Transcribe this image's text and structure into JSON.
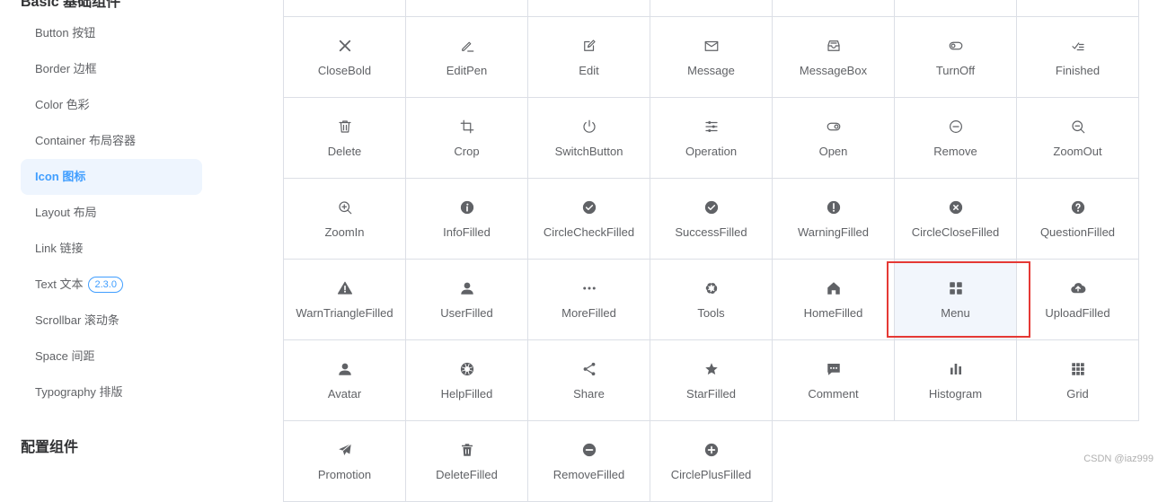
{
  "sidebar": {
    "group_basic": "Basic 基础组件",
    "items": [
      {
        "label": "Button 按钮"
      },
      {
        "label": "Border 边框"
      },
      {
        "label": "Color 色彩"
      },
      {
        "label": "Container 布局容器"
      },
      {
        "label": "Icon 图标",
        "active": true
      },
      {
        "label": "Layout 布局"
      },
      {
        "label": "Link 链接"
      },
      {
        "label": "Text 文本",
        "badge": "2.3.0"
      },
      {
        "label": "Scrollbar 滚动条"
      },
      {
        "label": "Space 间距"
      },
      {
        "label": "Typography 排版"
      }
    ],
    "group_config": "配置组件"
  },
  "icons": [
    {
      "label": "",
      "icon": "none"
    },
    {
      "label": "",
      "icon": "none"
    },
    {
      "label": "",
      "icon": "none"
    },
    {
      "label": "",
      "icon": "none"
    },
    {
      "label": "",
      "icon": "none"
    },
    {
      "label": "",
      "icon": "none"
    },
    {
      "label": "",
      "icon": "none"
    },
    {
      "label": "CloseBold",
      "icon": "close-bold-icon"
    },
    {
      "label": "EditPen",
      "icon": "edit-pen-icon"
    },
    {
      "label": "Edit",
      "icon": "edit-icon"
    },
    {
      "label": "Message",
      "icon": "message-icon"
    },
    {
      "label": "MessageBox",
      "icon": "message-box-icon"
    },
    {
      "label": "TurnOff",
      "icon": "turn-off-icon"
    },
    {
      "label": "Finished",
      "icon": "finished-icon"
    },
    {
      "label": "Delete",
      "icon": "delete-icon"
    },
    {
      "label": "Crop",
      "icon": "crop-icon"
    },
    {
      "label": "SwitchButton",
      "icon": "switch-button-icon"
    },
    {
      "label": "Operation",
      "icon": "operation-icon"
    },
    {
      "label": "Open",
      "icon": "open-icon"
    },
    {
      "label": "Remove",
      "icon": "remove-icon"
    },
    {
      "label": "ZoomOut",
      "icon": "zoom-out-icon"
    },
    {
      "label": "ZoomIn",
      "icon": "zoom-in-icon"
    },
    {
      "label": "InfoFilled",
      "icon": "info-filled-icon"
    },
    {
      "label": "CircleCheckFilled",
      "icon": "circle-check-filled-icon"
    },
    {
      "label": "SuccessFilled",
      "icon": "success-filled-icon"
    },
    {
      "label": "WarningFilled",
      "icon": "warning-filled-icon"
    },
    {
      "label": "CircleCloseFilled",
      "icon": "circle-close-filled-icon"
    },
    {
      "label": "QuestionFilled",
      "icon": "question-filled-icon"
    },
    {
      "label": "WarnTriangleFilled",
      "icon": "warn-triangle-filled-icon"
    },
    {
      "label": "UserFilled",
      "icon": "user-filled-icon"
    },
    {
      "label": "MoreFilled",
      "icon": "more-filled-icon"
    },
    {
      "label": "Tools",
      "icon": "tools-icon"
    },
    {
      "label": "HomeFilled",
      "icon": "home-filled-icon"
    },
    {
      "label": "Menu",
      "icon": "menu-icon",
      "highlighted": true
    },
    {
      "label": "UploadFilled",
      "icon": "upload-filled-icon"
    },
    {
      "label": "Avatar",
      "icon": "avatar-icon"
    },
    {
      "label": "HelpFilled",
      "icon": "help-filled-icon"
    },
    {
      "label": "Share",
      "icon": "share-icon"
    },
    {
      "label": "StarFilled",
      "icon": "star-filled-icon"
    },
    {
      "label": "Comment",
      "icon": "comment-icon"
    },
    {
      "label": "Histogram",
      "icon": "histogram-icon"
    },
    {
      "label": "Grid",
      "icon": "grid-icon"
    },
    {
      "label": "Promotion",
      "icon": "promotion-icon"
    },
    {
      "label": "DeleteFilled",
      "icon": "delete-filled-icon"
    },
    {
      "label": "RemoveFilled",
      "icon": "remove-filled-icon"
    },
    {
      "label": "CirclePlusFilled",
      "icon": "circle-plus-filled-icon"
    }
  ],
  "watermark": "CSDN @iaz999",
  "colors": {
    "accent": "#409eff",
    "active_bg": "#eef5fe",
    "highlight_border": "#e53935",
    "icon": "#606266"
  }
}
